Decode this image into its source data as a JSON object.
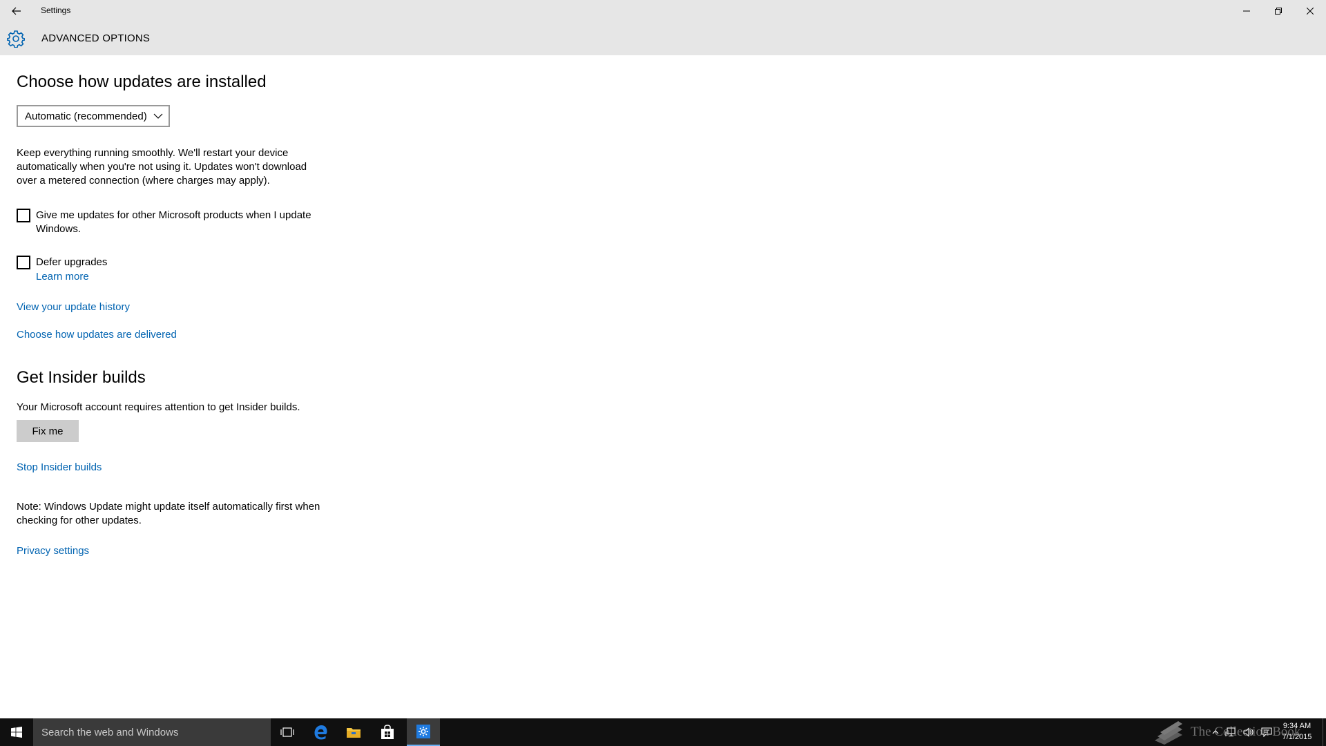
{
  "window": {
    "title": "Settings",
    "controls": {
      "minimize": "minimize-icon",
      "maximize": "restore-icon",
      "close": "close-icon"
    }
  },
  "header": {
    "title": "ADVANCED OPTIONS",
    "icon": "gear-icon"
  },
  "updates": {
    "heading": "Choose how updates are installed",
    "dropdown_value": "Automatic (recommended)",
    "description": "Keep everything running smoothly. We'll restart your device automatically when you're not using it. Updates won't download over a metered connection (where charges may apply).",
    "checkbox_other_products": {
      "label": "Give me updates for other Microsoft products when I update Windows.",
      "checked": false
    },
    "checkbox_defer": {
      "label": "Defer upgrades",
      "checked": false
    },
    "learn_more": "Learn more",
    "link_history": "View your update history",
    "link_delivered": "Choose how updates are delivered"
  },
  "insider": {
    "heading": "Get Insider builds",
    "message": "Your Microsoft account requires attention to get Insider builds.",
    "fix_button": "Fix me",
    "stop_link": "Stop Insider builds"
  },
  "note": "Note: Windows Update might update itself automatically first when checking for other updates.",
  "privacy_link": "Privacy settings",
  "taskbar": {
    "search_placeholder": "Search the web and Windows",
    "pinned": [
      "task-view-icon",
      "edge-icon",
      "file-explorer-icon",
      "store-icon",
      "settings-icon"
    ],
    "clock_time": "9:34 AM",
    "clock_date": "7/1/2015"
  },
  "watermark": "The Collection Book",
  "colors": {
    "accent": "#0063b1",
    "chrome": "#e6e6e6",
    "taskbar": "#101010"
  }
}
